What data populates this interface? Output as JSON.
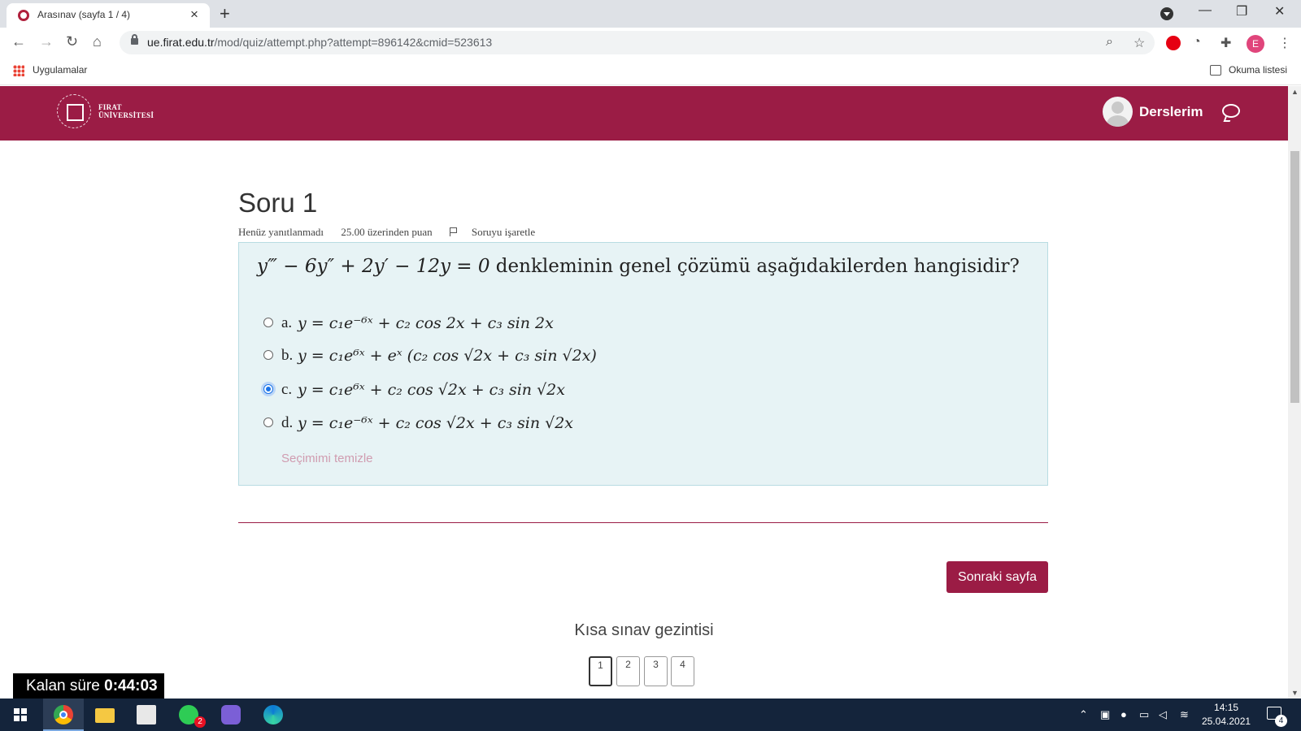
{
  "browser": {
    "tab_title": "Arasınav (sayfa 1 / 4)",
    "url_host": "ue.firat.edu.tr",
    "url_path": "/mod/quiz/attempt.php?attempt=896142&cmid=523613",
    "profile_initial": "E"
  },
  "bookmarks": {
    "apps_label": "Uygulamalar",
    "reading_list_label": "Okuma listesi"
  },
  "site": {
    "logo_line1": "FIRAT",
    "logo_line2": "ÜNİVERSİTESİ",
    "my_courses": "Derslerim",
    "brand_color": "#9b1c45"
  },
  "question": {
    "title": "Soru 1",
    "status": "Henüz yanıtlanmadı",
    "points": "25.00 üzerinden puan",
    "flag": "Soruyu işaretle",
    "text_math": "y‴ − 6y″ + 2y′ − 12y = 0",
    "text_rest": " denkleminin genel çözümü aşağıdakilerden hangisidir?",
    "options": [
      {
        "letter": "a.",
        "math": "y = c₁e⁻⁶ˣ + c₂ cos 2x + c₃ sin 2x",
        "selected": false
      },
      {
        "letter": "b.",
        "math": "y = c₁e⁶ˣ + eˣ (c₂ cos √2x + c₃ sin √2x)",
        "selected": false
      },
      {
        "letter": "c.",
        "math": "y = c₁e⁶ˣ + c₂ cos √2x + c₃ sin √2x",
        "selected": true
      },
      {
        "letter": "d.",
        "math": "y = c₁e⁻⁶ˣ + c₂ cos √2x + c₃ sin √2x",
        "selected": false
      }
    ],
    "clear_choice": "Seçimimi temizle"
  },
  "next_button": "Sonraki sayfa",
  "quiz_nav": {
    "title": "Kısa sınav gezintisi",
    "pages": [
      "1",
      "2",
      "3",
      "4"
    ],
    "current": "1"
  },
  "timer": {
    "label": "Kalan süre",
    "value": "0:44:03"
  },
  "taskbar": {
    "whatsapp_badge": "2",
    "time": "14:15",
    "date": "25.04.2021",
    "notification_count": "4"
  }
}
